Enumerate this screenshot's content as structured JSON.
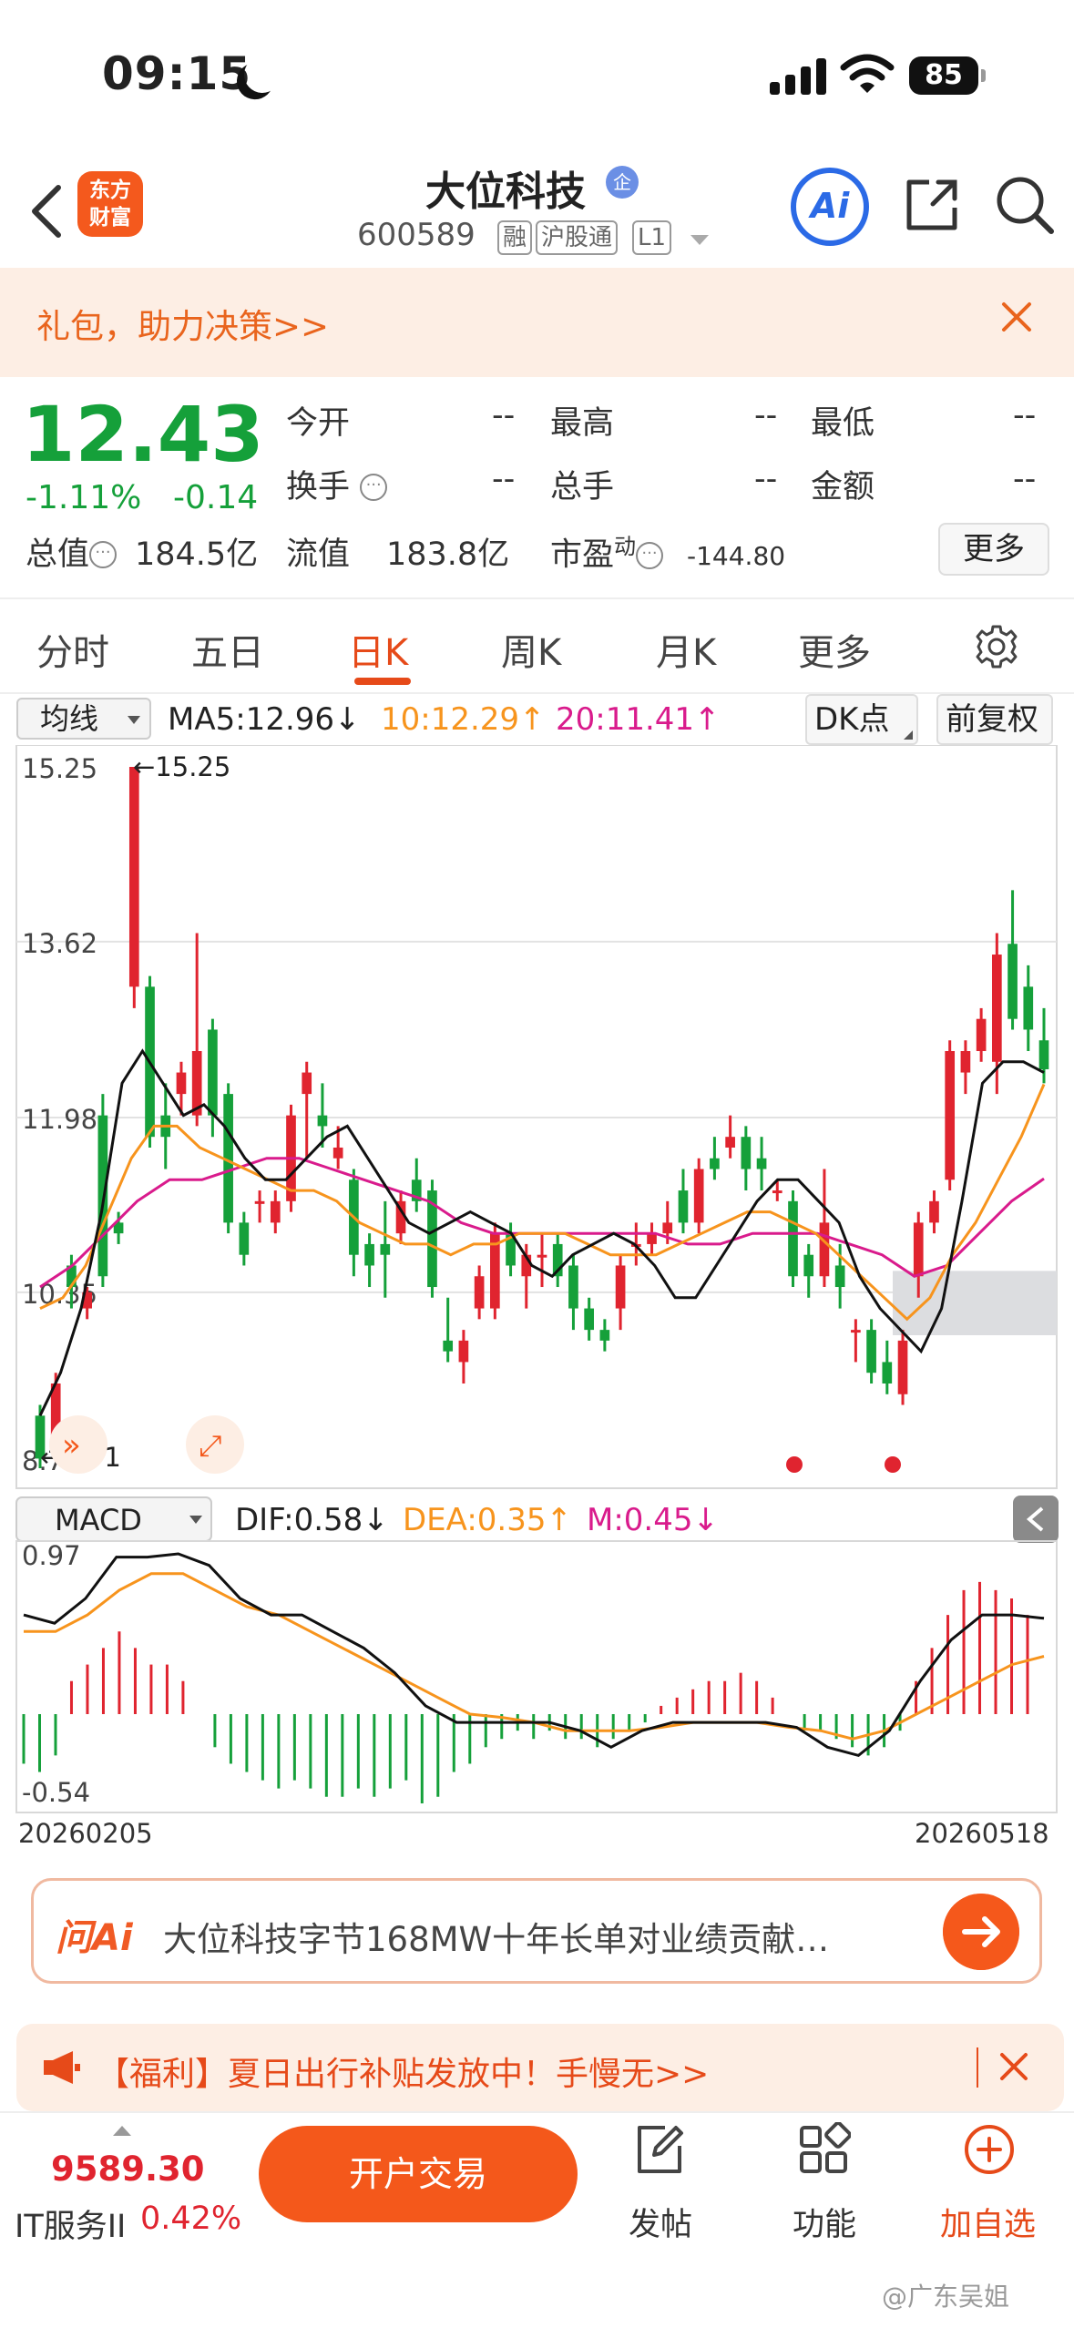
{
  "status_bar": {
    "time": "09:15",
    "battery": "85"
  },
  "nav": {
    "logo_line1": "东方",
    "logo_line2": "财富",
    "stock_name": "大位科技",
    "enterprise_badge": "企",
    "stock_code": "600589",
    "tags": [
      "融",
      "沪股通",
      "L1"
    ],
    "ai_label": "Ai"
  },
  "promo": {
    "text": "礼包，助力决策>>"
  },
  "quote": {
    "price": "12.43",
    "change_pct": "-1.11%",
    "change_val": "-0.14",
    "fields": [
      {
        "label": "今开",
        "value": "--"
      },
      {
        "label": "最高",
        "value": "--"
      },
      {
        "label": "最低",
        "value": "--"
      },
      {
        "label": "换手",
        "value": "--"
      },
      {
        "label": "总手",
        "value": "--"
      },
      {
        "label": "金额",
        "value": "--"
      }
    ],
    "total_cap_label": "总值",
    "total_cap_value": "184.5亿",
    "float_cap_label": "流值",
    "float_cap_value": "183.8亿",
    "pe_label": "市盈",
    "pe_sup": "动",
    "pe_value": "-144.80",
    "more_label": "更多"
  },
  "tabs": [
    "分时",
    "五日",
    "日K",
    "周K",
    "月K",
    "更多"
  ],
  "active_tab": "日K",
  "ma_bar": {
    "dropdown": "均线",
    "ma5": "MA5:12.96↓",
    "ma10": "10:12.29↑",
    "ma20": "20:11.41↑",
    "dk_button": "DK点",
    "adjust_button": "前复权"
  },
  "macd_bar": {
    "dropdown": "MACD",
    "dif": "DIF:0.58↓",
    "dea": "DEA:0.35↑",
    "m": "M:0.45↓"
  },
  "colors": {
    "up": "#e0242f",
    "down": "#15a03a",
    "ma10": "#f7941d",
    "ma20": "#d91b8c",
    "accent": "#f4581b"
  },
  "chart_data": {
    "type": "candlestick",
    "y_ticks": [
      "15.25",
      "13.62",
      "11.98",
      "10.35",
      "8.71"
    ],
    "ylim": [
      8.71,
      15.25
    ],
    "max_label": "15.25",
    "min_label": "8.71",
    "x_range": [
      "20260205",
      "20260518"
    ],
    "candles": [
      {
        "o": 9.2,
        "c": 8.8,
        "h": 9.3,
        "l": 8.71
      },
      {
        "o": 8.9,
        "c": 9.5,
        "h": 9.6,
        "l": 8.8
      },
      {
        "o": 10.6,
        "c": 10.4,
        "h": 10.7,
        "l": 10.2
      },
      {
        "o": 10.2,
        "c": 10.35,
        "h": 10.4,
        "l": 10.1
      },
      {
        "o": 12.0,
        "c": 10.5,
        "h": 12.2,
        "l": 10.4
      },
      {
        "o": 11.0,
        "c": 10.9,
        "h": 11.1,
        "l": 10.8
      },
      {
        "o": 13.2,
        "c": 15.25,
        "h": 15.25,
        "l": 13.0
      },
      {
        "o": 13.2,
        "c": 11.8,
        "h": 13.3,
        "l": 11.7
      },
      {
        "o": 12.0,
        "c": 11.8,
        "h": 12.3,
        "l": 11.5
      },
      {
        "o": 12.2,
        "c": 12.4,
        "h": 12.5,
        "l": 12.0
      },
      {
        "o": 12.0,
        "c": 12.6,
        "h": 13.7,
        "l": 11.9
      },
      {
        "o": 12.8,
        "c": 12.0,
        "h": 12.9,
        "l": 11.8
      },
      {
        "o": 12.2,
        "c": 11.0,
        "h": 12.3,
        "l": 10.9
      },
      {
        "o": 11.0,
        "c": 10.7,
        "h": 11.1,
        "l": 10.6
      },
      {
        "o": 11.2,
        "c": 11.2,
        "h": 11.3,
        "l": 11.0
      },
      {
        "o": 11.0,
        "c": 11.2,
        "h": 11.3,
        "l": 10.9
      },
      {
        "o": 11.2,
        "c": 12.0,
        "h": 12.1,
        "l": 11.1
      },
      {
        "o": 12.2,
        "c": 12.4,
        "h": 12.5,
        "l": 11.6
      },
      {
        "o": 12.0,
        "c": 11.9,
        "h": 12.3,
        "l": 11.7
      },
      {
        "o": 11.6,
        "c": 11.7,
        "h": 11.9,
        "l": 11.5
      },
      {
        "o": 11.4,
        "c": 10.7,
        "h": 11.5,
        "l": 10.5
      },
      {
        "o": 10.8,
        "c": 10.6,
        "h": 10.9,
        "l": 10.4
      },
      {
        "o": 10.8,
        "c": 10.7,
        "h": 11.2,
        "l": 10.3
      },
      {
        "o": 10.9,
        "c": 11.2,
        "h": 11.3,
        "l": 10.8
      },
      {
        "o": 11.4,
        "c": 11.2,
        "h": 11.6,
        "l": 11.1
      },
      {
        "o": 11.3,
        "c": 10.4,
        "h": 11.4,
        "l": 10.3
      },
      {
        "o": 9.9,
        "c": 9.8,
        "h": 10.3,
        "l": 9.7
      },
      {
        "o": 9.7,
        "c": 9.9,
        "h": 10.0,
        "l": 9.5
      },
      {
        "o": 10.2,
        "c": 10.5,
        "h": 10.6,
        "l": 10.1
      },
      {
        "o": 10.2,
        "c": 10.9,
        "h": 11.0,
        "l": 10.1
      },
      {
        "o": 10.9,
        "c": 10.6,
        "h": 11.0,
        "l": 10.5
      },
      {
        "o": 10.5,
        "c": 10.7,
        "h": 10.8,
        "l": 10.2
      },
      {
        "o": 10.7,
        "c": 10.7,
        "h": 10.9,
        "l": 10.4
      },
      {
        "o": 10.8,
        "c": 10.5,
        "h": 10.9,
        "l": 10.4
      },
      {
        "o": 10.6,
        "c": 10.2,
        "h": 10.7,
        "l": 10.0
      },
      {
        "o": 10.2,
        "c": 10.0,
        "h": 10.3,
        "l": 9.9
      },
      {
        "o": 10.0,
        "c": 9.9,
        "h": 10.1,
        "l": 9.8
      },
      {
        "o": 10.2,
        "c": 10.6,
        "h": 10.7,
        "l": 10.0
      },
      {
        "o": 10.8,
        "c": 10.8,
        "h": 11.0,
        "l": 10.6
      },
      {
        "o": 10.8,
        "c": 10.9,
        "h": 11.0,
        "l": 10.7
      },
      {
        "o": 10.9,
        "c": 11.0,
        "h": 11.2,
        "l": 10.8
      },
      {
        "o": 11.3,
        "c": 11.0,
        "h": 11.5,
        "l": 10.9
      },
      {
        "o": 11.0,
        "c": 11.5,
        "h": 11.6,
        "l": 10.9
      },
      {
        "o": 11.6,
        "c": 11.5,
        "h": 11.8,
        "l": 11.4
      },
      {
        "o": 11.7,
        "c": 11.8,
        "h": 12.0,
        "l": 11.6
      },
      {
        "o": 11.8,
        "c": 11.5,
        "h": 11.9,
        "l": 11.3
      },
      {
        "o": 11.6,
        "c": 11.5,
        "h": 11.8,
        "l": 11.3
      },
      {
        "o": 11.3,
        "c": 11.3,
        "h": 11.4,
        "l": 11.2
      },
      {
        "o": 11.2,
        "c": 10.5,
        "h": 11.3,
        "l": 10.4
      },
      {
        "o": 10.7,
        "c": 10.5,
        "h": 10.8,
        "l": 10.3
      },
      {
        "o": 10.5,
        "c": 11.0,
        "h": 11.5,
        "l": 10.4
      },
      {
        "o": 10.6,
        "c": 10.4,
        "h": 10.8,
        "l": 10.2
      },
      {
        "o": 10.0,
        "c": 10.0,
        "h": 10.1,
        "l": 9.7
      },
      {
        "o": 10.0,
        "c": 9.6,
        "h": 10.1,
        "l": 9.5
      },
      {
        "o": 9.7,
        "c": 9.5,
        "h": 9.9,
        "l": 9.4
      },
      {
        "o": 9.4,
        "c": 9.9,
        "h": 10.0,
        "l": 9.3
      },
      {
        "o": 10.5,
        "c": 11.0,
        "h": 11.1,
        "l": 10.3
      },
      {
        "o": 11.0,
        "c": 11.2,
        "h": 11.3,
        "l": 10.9
      },
      {
        "o": 11.4,
        "c": 12.6,
        "h": 12.7,
        "l": 11.3
      },
      {
        "o": 12.4,
        "c": 12.6,
        "h": 12.7,
        "l": 12.2
      },
      {
        "o": 12.6,
        "c": 12.9,
        "h": 13.0,
        "l": 12.5
      },
      {
        "o": 12.5,
        "c": 13.5,
        "h": 13.7,
        "l": 12.2
      },
      {
        "o": 13.6,
        "c": 12.9,
        "h": 14.1,
        "l": 12.8
      },
      {
        "o": 13.2,
        "c": 12.8,
        "h": 13.4,
        "l": 12.6
      },
      {
        "o": 12.7,
        "c": 12.43,
        "h": 13.0,
        "l": 12.3
      }
    ],
    "ma5": [
      9.2,
      9.6,
      10.2,
      11.1,
      12.3,
      12.6,
      12.3,
      12.0,
      12.1,
      11.9,
      11.6,
      11.4,
      11.4,
      11.6,
      11.8,
      11.9,
      11.6,
      11.3,
      11.0,
      10.9,
      11.0,
      11.1,
      11.0,
      10.9,
      10.6,
      10.5,
      10.7,
      10.8,
      10.9,
      10.8,
      10.6,
      10.3,
      10.3,
      10.6,
      10.9,
      11.2,
      11.4,
      11.4,
      11.2,
      11.0,
      10.5,
      10.2,
      10.0,
      9.8,
      10.2,
      11.2,
      12.3,
      12.5,
      12.5,
      12.4
    ],
    "ma10": [
      10.2,
      10.3,
      10.6,
      11.1,
      11.6,
      11.9,
      11.9,
      11.7,
      11.6,
      11.5,
      11.4,
      11.3,
      11.3,
      11.2,
      11.0,
      10.9,
      10.8,
      10.8,
      10.7,
      10.8,
      10.8,
      10.9,
      10.9,
      10.9,
      10.8,
      10.7,
      10.7,
      10.7,
      10.8,
      10.9,
      11.0,
      11.1,
      11.1,
      11.0,
      10.9,
      10.7,
      10.5,
      10.3,
      10.1,
      10.3,
      10.7,
      11.0,
      11.4,
      11.8,
      12.29
    ],
    "ma20": [
      10.4,
      10.6,
      10.9,
      11.2,
      11.4,
      11.4,
      11.5,
      11.6,
      11.6,
      11.5,
      11.4,
      11.3,
      11.2,
      11.0,
      10.9,
      10.9,
      10.9,
      10.9,
      10.9,
      10.9,
      10.8,
      10.8,
      10.9,
      10.9,
      10.9,
      10.8,
      10.7,
      10.5,
      10.6,
      10.9,
      11.2,
      11.41
    ],
    "macd_ylim": [
      -0.54,
      0.97
    ],
    "macd_ticks": [
      "0.97",
      "-0.54"
    ],
    "dif": [
      0.6,
      0.55,
      0.7,
      0.95,
      0.95,
      0.97,
      0.9,
      0.7,
      0.6,
      0.6,
      0.5,
      0.4,
      0.25,
      0.05,
      -0.05,
      -0.05,
      -0.05,
      -0.05,
      -0.1,
      -0.2,
      -0.1,
      -0.05,
      -0.05,
      -0.05,
      -0.05,
      -0.08,
      -0.2,
      -0.25,
      -0.1,
      0.2,
      0.45,
      0.6,
      0.6,
      0.58
    ],
    "dea": [
      0.5,
      0.5,
      0.6,
      0.75,
      0.85,
      0.85,
      0.75,
      0.65,
      0.6,
      0.5,
      0.4,
      0.3,
      0.2,
      0.1,
      0.0,
      -0.02,
      -0.05,
      -0.1,
      -0.1,
      -0.1,
      -0.08,
      -0.05,
      -0.05,
      -0.05,
      -0.08,
      -0.1,
      -0.15,
      -0.1,
      0.0,
      0.1,
      0.2,
      0.3,
      0.35
    ],
    "macd_hist": [
      -0.3,
      -0.35,
      -0.25,
      0.2,
      0.3,
      0.4,
      0.5,
      0.4,
      0.3,
      0.3,
      0.2,
      0.0,
      -0.2,
      -0.3,
      -0.35,
      -0.4,
      -0.45,
      -0.4,
      -0.45,
      -0.5,
      -0.5,
      -0.45,
      -0.5,
      -0.45,
      -0.4,
      -0.54,
      -0.5,
      -0.35,
      -0.3,
      -0.2,
      -0.15,
      -0.1,
      -0.15,
      -0.1,
      -0.15,
      -0.15,
      -0.2,
      -0.15,
      -0.1,
      -0.05,
      0.05,
      0.1,
      0.15,
      0.2,
      0.2,
      0.25,
      0.2,
      0.1,
      0.0,
      -0.1,
      -0.1,
      -0.15,
      -0.2,
      -0.25,
      -0.2,
      -0.1,
      0.2,
      0.4,
      0.6,
      0.75,
      0.8,
      0.75,
      0.7,
      0.6
    ]
  },
  "ask_ai": {
    "logo": "问Ai",
    "text": "大位科技字节168MW十年长单对业绩贡献…"
  },
  "notice": {
    "text": "【福利】夏日出行补贴发放中！手慢无>>"
  },
  "bottom": {
    "index_value": "9589.30",
    "index_name": "IT服务II",
    "index_pct": "0.42%",
    "trade_label": "开户交易",
    "post_label": "发帖",
    "func_label": "功能",
    "watch_label": "加自选"
  },
  "watermark": "@广东吴姐"
}
